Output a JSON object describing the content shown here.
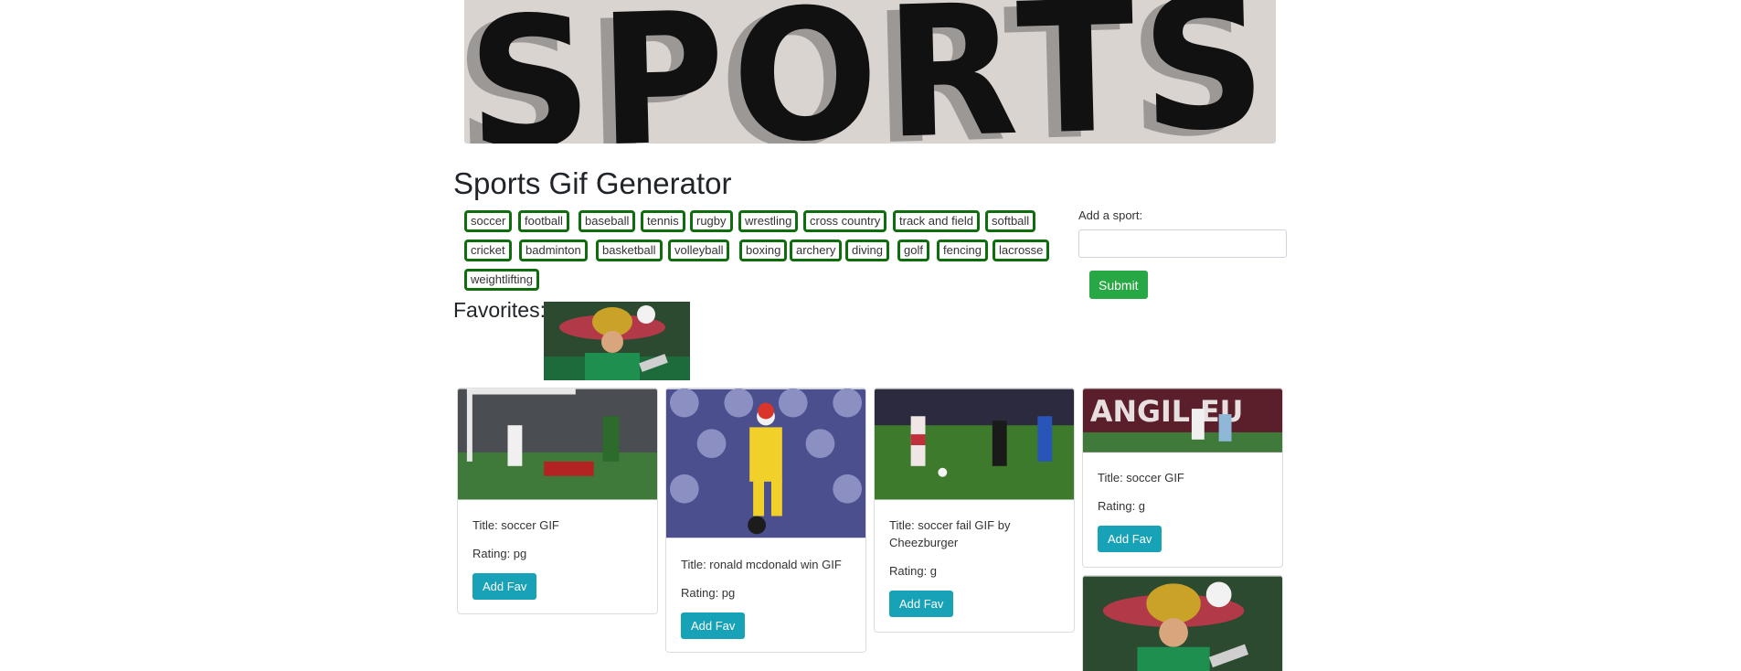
{
  "banner": {
    "text": "SPORTS"
  },
  "page_title": "Sports Gif Generator",
  "sports": [
    [
      "soccer",
      "football",
      "baseball",
      "tennis",
      "rugby",
      "wrestling",
      "cross country",
      "track and field",
      "softball"
    ],
    [
      "cricket",
      "badminton",
      "basketball",
      "volleyball",
      "boxing",
      "archery",
      "diving",
      "golf",
      "fencing",
      "lacrosse"
    ],
    [
      "weightlifting"
    ]
  ],
  "form": {
    "label": "Add a sport:",
    "input_value": "",
    "submit_label": "Submit"
  },
  "favorites": {
    "label": "Favorites:"
  },
  "cards": [
    {
      "title": "Title: soccer GIF",
      "rating": "Rating: pg",
      "button": "Add Fav"
    },
    {
      "title": "Title: ronald mcdonald win GIF",
      "rating": "Rating: pg",
      "button": "Add Fav"
    },
    {
      "title": "Title: soccer fail GIF by Cheezburger",
      "rating": "Rating: g",
      "button": "Add Fav"
    },
    {
      "title": "Title: soccer GIF",
      "rating": "Rating: g",
      "button": "Add Fav"
    }
  ],
  "colors": {
    "sport_border": "#0e6e0e",
    "submit": "#28a745",
    "fav_button": "#17a2b8"
  }
}
